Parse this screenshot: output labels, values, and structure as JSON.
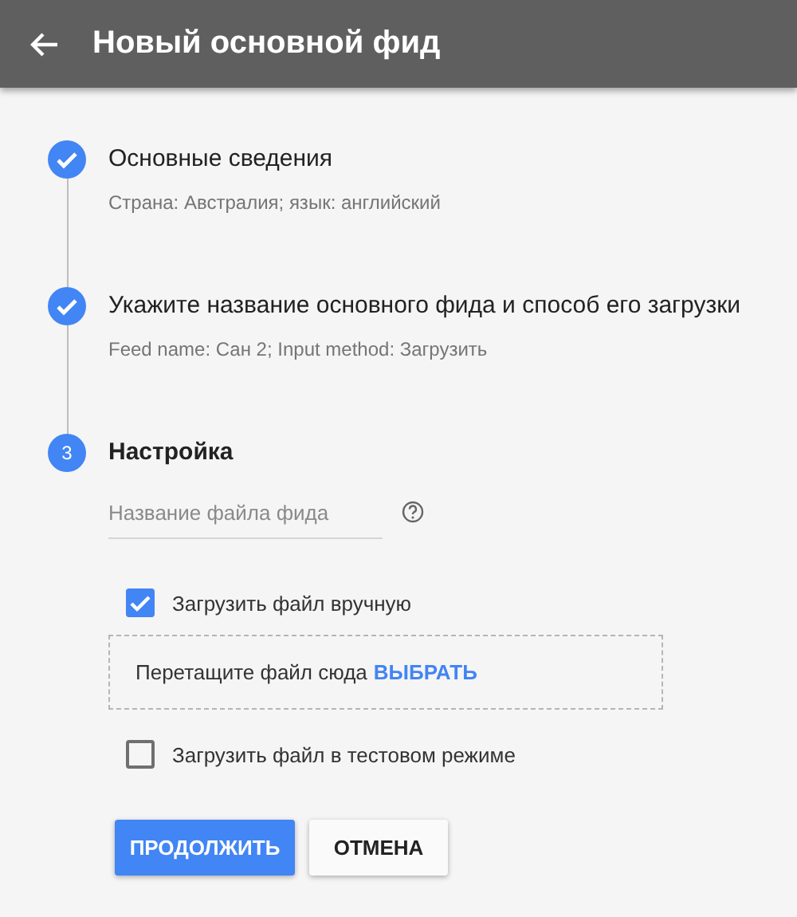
{
  "header": {
    "title": "Новый основной фид"
  },
  "steps": [
    {
      "kind": "done",
      "title": "Основные сведения",
      "summary": "Страна: Австралия; язык: английский"
    },
    {
      "kind": "done",
      "title": "Укажите название основного фида и способ его загрузки",
      "summary": "Feed name: Сан 2; Input method: Загрузить"
    },
    {
      "kind": "current",
      "number": "3",
      "title": "Настройка"
    }
  ],
  "settings": {
    "file_name_field": {
      "placeholder": "Название файла фида"
    },
    "manual_upload": {
      "label": "Загрузить файл вручную",
      "checked": true
    },
    "drop_zone": {
      "text": "Перетащите файл сюда",
      "link": "ВЫБРАТЬ"
    },
    "test_mode": {
      "label": "Загрузить файл в тестовом режиме",
      "checked": false
    }
  },
  "buttons": [
    {
      "label": "ПРОДОЛЖИТЬ",
      "kind": "primary"
    },
    {
      "label": "ОТМЕНА",
      "kind": "secondary"
    }
  ]
}
